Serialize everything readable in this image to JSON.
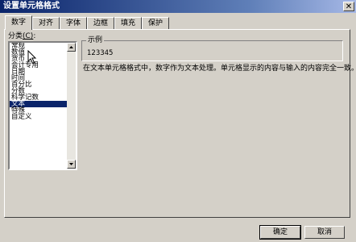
{
  "window": {
    "title": "设置单元格格式",
    "close_glyph": "✕"
  },
  "tabs": [
    {
      "label": "数字",
      "active": true
    },
    {
      "label": "对齐"
    },
    {
      "label": "字体"
    },
    {
      "label": "边框"
    },
    {
      "label": "填充"
    },
    {
      "label": "保护"
    }
  ],
  "category": {
    "label_text": "分类",
    "label_accel": "(C)",
    "label_suffix": ":",
    "items": [
      "常规",
      "数值",
      "货币",
      "会计专用",
      "日期",
      "时间",
      "百分比",
      "分数",
      "科学记数",
      "文本",
      "特殊",
      "自定义"
    ],
    "selected": "文本"
  },
  "sample": {
    "legend": "示例",
    "value": "123345"
  },
  "description": "在文本单元格格式中，数字作为文本处理。单元格显示的内容与输入的内容完全一致。",
  "buttons": {
    "ok": "确定",
    "cancel": "取消"
  },
  "icons": {
    "close": "close-icon",
    "scroll_up": "arrow-up-icon",
    "scroll_down": "arrow-down-icon",
    "cursor": "mouse-pointer-icon"
  },
  "colors": {
    "titlebar_start": "#0a246a",
    "titlebar_end": "#a6b8e6",
    "selection": "#0a246a",
    "face": "#d4d0c8"
  }
}
